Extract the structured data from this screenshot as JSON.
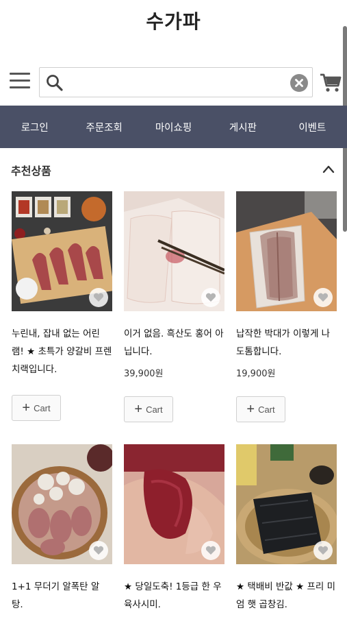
{
  "header": {
    "title": "수가파"
  },
  "search": {
    "placeholder": "",
    "value": ""
  },
  "nav": {
    "items": [
      "로그인",
      "주문조회",
      "마이쇼핑",
      "게시판",
      "이벤트"
    ]
  },
  "section": {
    "title": "추천상품"
  },
  "cart_button_label": "Cart",
  "cart_button_plus": "+",
  "products": [
    {
      "name": "누린내, 잡내 없는 어린 램! ★ 초특가 양갈비 프렌치랙입니다.",
      "price": ""
    },
    {
      "name": "이거 없음. 흑산도 홍어 아닙니다.",
      "price": "39,900원"
    },
    {
      "name": "납작한 박대가 이렇게 나 도톰합니다.",
      "price": "19,900원"
    },
    {
      "name": "1+1 무더기 알폭탄 알 탕.",
      "price": ""
    },
    {
      "name": "★ 당일도축! 1등급 한 우 육사시미.",
      "price": ""
    },
    {
      "name": "★ 택배비 반값 ★ 프리 미엄 햇 곱창김.",
      "price": ""
    }
  ],
  "colors": {
    "nav_bg": "#4a5066",
    "nav_text": "#ffffff"
  },
  "icons": [
    "menu-icon",
    "search-icon",
    "clear-icon",
    "cart-icon",
    "chevron-up-icon",
    "heart-icon",
    "plus-icon"
  ]
}
